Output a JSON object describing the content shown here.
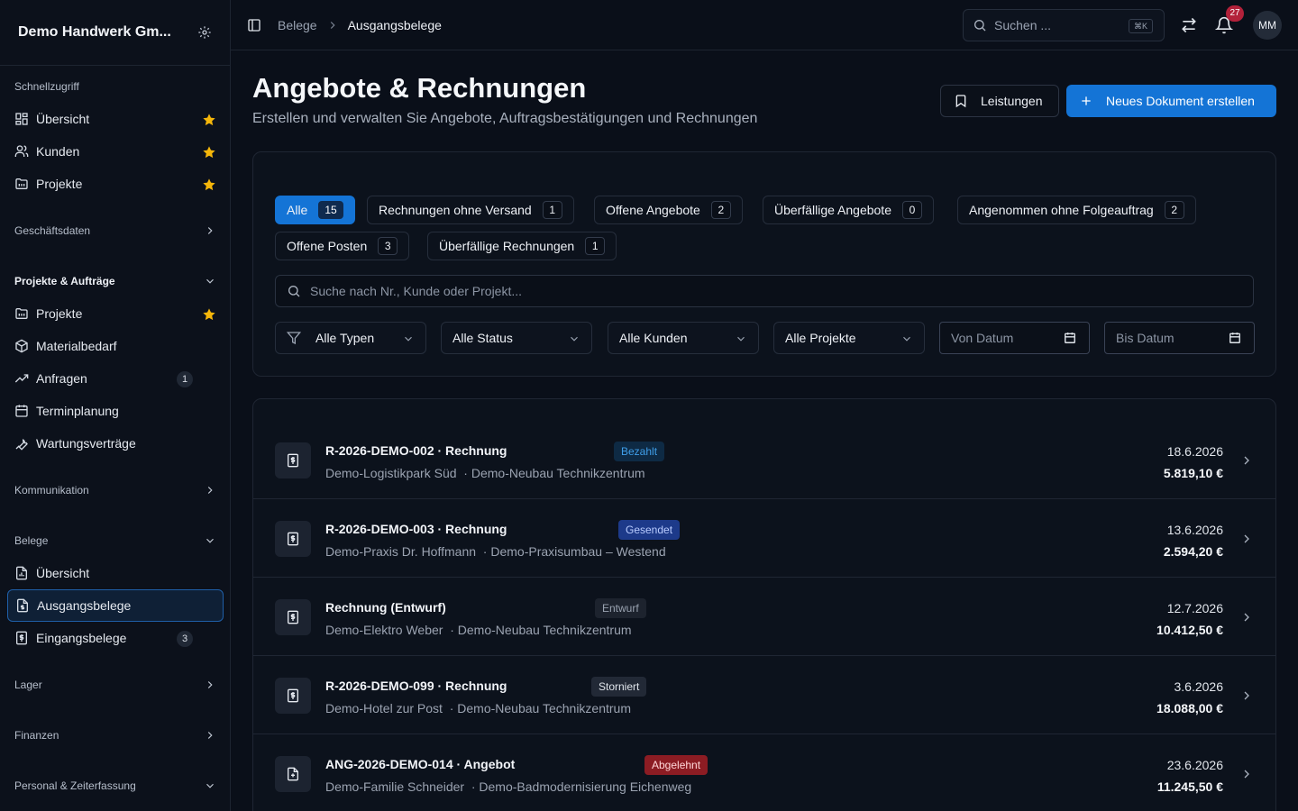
{
  "sidebar": {
    "org_name": "Demo Handwerk Gm...",
    "sections": {
      "quick": "Schnellzugriff",
      "business": "Geschäftsdaten",
      "projects": "Projekte & Aufträge",
      "communication": "Kommunikation",
      "documents": "Belege",
      "stock": "Lager",
      "finance": "Finanzen",
      "staff": "Personal & Zeiterfassung"
    },
    "quick": [
      "Übersicht",
      "Kunden",
      "Projekte"
    ],
    "projects": [
      "Projekte",
      "Materialbedarf",
      "Anfragen",
      "Terminplanung",
      "Wartungsverträge"
    ],
    "requests_count": "1",
    "documents": [
      "Übersicht",
      "Ausgangsbelege",
      "Eingangsbelege"
    ],
    "incoming_count": "3"
  },
  "topbar": {
    "breadcrumb": [
      "Belege",
      "Ausgangsbelege"
    ],
    "search_placeholder": "Suchen ...",
    "shortcut": "⌘K",
    "notifications": "27",
    "avatar": "MM"
  },
  "header": {
    "title": "Angebote & Rechnungen",
    "subtitle": "Erstellen und verwalten Sie Angebote, Auftragsbestätigungen und Rechnungen",
    "services_button": "Leistungen",
    "new_button": "Neues Dokument erstellen"
  },
  "filters": {
    "chips": [
      {
        "label": "Alle",
        "count": "15"
      },
      {
        "label": "Rechnungen ohne Versand",
        "count": "1"
      },
      {
        "label": "Offene Angebote",
        "count": "2"
      },
      {
        "label": "Überfällige Angebote",
        "count": "0"
      },
      {
        "label": "Angenommen ohne Folgeauftrag",
        "count": "2"
      },
      {
        "label": "Offene Posten",
        "count": "3"
      },
      {
        "label": "Überfällige Rechnungen",
        "count": "1"
      }
    ],
    "search_placeholder": "Suche nach Nr., Kunde oder Projekt...",
    "types": "Alle Typen",
    "status": "Alle Status",
    "customers": "Alle Kunden",
    "projects": "Alle Projekte",
    "from_date": "Von Datum",
    "to_date": "Bis Datum"
  },
  "documents": [
    {
      "title": "R-2026-DEMO-002 · Rechnung",
      "status": "Bezahlt",
      "customer": "Demo-Logistikpark Süd",
      "project": "· Demo-Neubau Technikzentrum",
      "date": "18.6.2026",
      "amount": "5.819,10 €"
    },
    {
      "title": "R-2026-DEMO-003 · Rechnung",
      "status": "Gesendet",
      "customer": "Demo-Praxis Dr. Hoffmann",
      "project": "· Demo-Praxisumbau – Westend",
      "date": "13.6.2026",
      "amount": "2.594,20 €"
    },
    {
      "title": "Rechnung (Entwurf)",
      "status": "Entwurf",
      "customer": "Demo-Elektro Weber",
      "project": "· Demo-Neubau Technikzentrum",
      "date": "12.7.2026",
      "amount": "10.412,50 €"
    },
    {
      "title": "R-2026-DEMO-099 · Rechnung",
      "status": "Storniert",
      "customer": "Demo-Hotel zur Post",
      "project": "· Demo-Neubau Technikzentrum",
      "date": "3.6.2026",
      "amount": "18.088,00 €"
    },
    {
      "title": "ANG-2026-DEMO-014 · Angebot",
      "status": "Abgelehnt",
      "customer": "Demo-Familie Schneider",
      "project": "· Demo-Badmodernisierung Eichenweg",
      "date": "23.6.2026",
      "amount": "11.245,50 €"
    }
  ],
  "colors": {
    "accent": "#1474d6",
    "star": "#f5b60a",
    "notification": "#b3213a"
  }
}
